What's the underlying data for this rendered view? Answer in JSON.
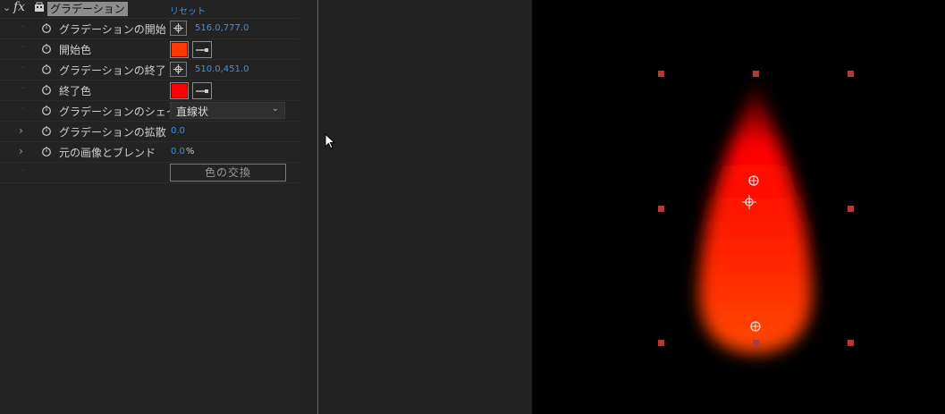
{
  "effect": {
    "name": "グラデーション",
    "reset_label": "リセット",
    "fx_label": "fx"
  },
  "params": {
    "start_label": "グラデーションの開始",
    "start_value": "516.0,777.0",
    "start_color_label": "開始色",
    "start_color": "#ff3a00",
    "end_label": "グラデーションの終了",
    "end_value": "510.0,451.0",
    "end_color_label": "終了色",
    "end_color": "#ff0000",
    "shape_label": "グラデーションのシェイ",
    "shape_value": "直線状",
    "scatter_label": "グラデーションの拡散",
    "scatter_value": "0.0",
    "blend_label": "元の画像とブレンド",
    "blend_value": "0.0",
    "blend_unit": "%",
    "swap_label": "色の交換"
  },
  "colors": {
    "panel_bg": "#232323",
    "value_blue": "#3d8fe8",
    "playhead": "#2d6fd6",
    "handle": "#b03a3a"
  }
}
